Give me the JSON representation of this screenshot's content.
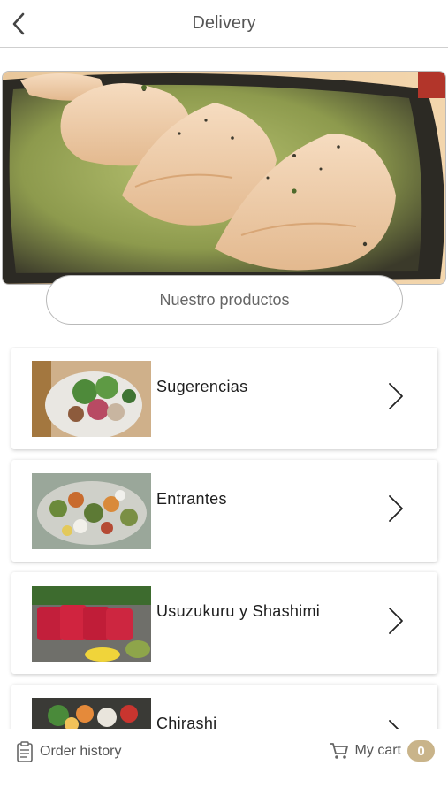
{
  "header": {
    "title": "Delivery",
    "back_icon": "chevron-left-icon"
  },
  "hero": {
    "image": "gyoza-dumplings-on-green-plate"
  },
  "products_button": {
    "label": "Nuestro productos"
  },
  "categories": [
    {
      "label": "Sugerencias",
      "image": "salad-with-radish-and-greens"
    },
    {
      "label": "Entrantes",
      "image": "mixed-salad-platter"
    },
    {
      "label": "Usuzukuru y Shashimi",
      "image": "tuna-sashimi-slices"
    },
    {
      "label": "Chirashi",
      "image": "chirashi-bowl"
    }
  ],
  "footer": {
    "order_history_label": "Order history",
    "order_history_icon": "clipboard-icon",
    "cart_label": "My cart",
    "cart_icon": "shopping-cart-icon",
    "cart_count": "0"
  },
  "colors": {
    "badge": "#c9b48a",
    "divider": "#cfcfcf",
    "text_secondary": "#555555"
  }
}
